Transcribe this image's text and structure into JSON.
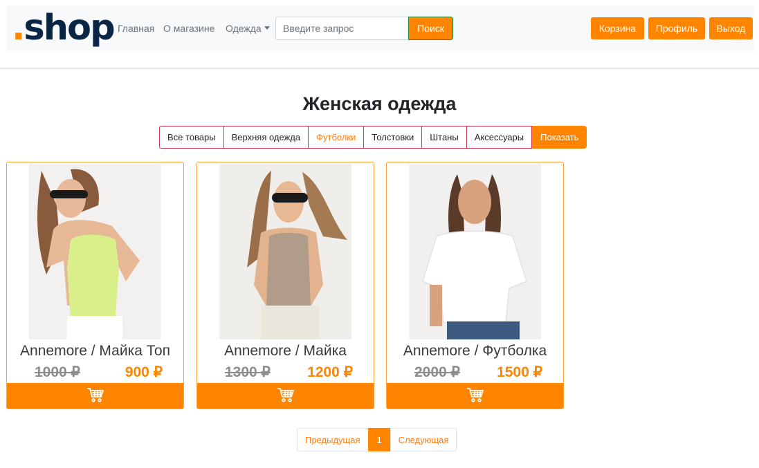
{
  "brand": {
    "logo_dot": ".",
    "logo_text": "shop"
  },
  "nav": {
    "links": [
      "Главная",
      "О магазине",
      "Одежда"
    ],
    "search_placeholder": "Введите запрос",
    "search_button": "Поиск",
    "buttons": [
      "Корзина",
      "Профиль",
      "Выход"
    ]
  },
  "page": {
    "title": "Женская одежда"
  },
  "filters": {
    "items": [
      "Все товары",
      "Верхняя одежда",
      "Футболки",
      "Толстовки",
      "Штаны",
      "Аксессуары"
    ],
    "active": "Футболки",
    "show_button": "Показать"
  },
  "products": [
    {
      "name": "Annemore / Майка Топ",
      "old_price": "1000 ₽",
      "price": "900 ₽",
      "top_color": "#d9f08a"
    },
    {
      "name": "Annemore / Майка",
      "old_price": "1300 ₽",
      "price": "1200 ₽",
      "top_color": "#b09c88"
    },
    {
      "name": "Annemore / Футболка",
      "old_price": "2000 ₽",
      "price": "1500 ₽",
      "top_color": "#ffffff"
    }
  ],
  "pagination": {
    "prev": "Предыдущая",
    "current": "1",
    "next": "Следующая"
  },
  "colors": {
    "accent": "#ff8500",
    "logo": "#0b2545",
    "filter_border": "#c6394f"
  },
  "icons": {
    "cart": "cart-icon",
    "caret": "caret-down-icon"
  }
}
